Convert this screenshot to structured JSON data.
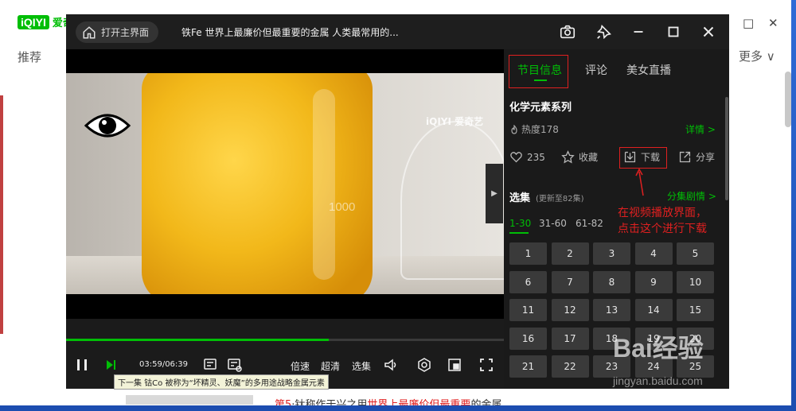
{
  "background": {
    "logo_box": "iQIYI",
    "logo_text": "爱奇",
    "nav_label": "推荐",
    "more_label": "更多 ∨",
    "minimize_icon": "□",
    "close_icon": "✕",
    "bottom_line_plain1": "第5",
    "bottom_line_plain2": "·钛称作于兴之用",
    "bottom_line_red1": "世界上最廉价但最重要",
    "bottom_line_plain3": "的金属"
  },
  "player": {
    "home_button": "打开主界面",
    "title": "铁Fe 世界上最廉价但最重要的金属 人类最常用的...",
    "watermark": "iQIYI 爱奇艺",
    "beaker_label": "1000",
    "time": "03:59/06:39",
    "tooltip": "下一集 钴Co 被称为“坏精灵、妖魔”的多用途战略金属元素",
    "ctrl_speed": "倍速",
    "ctrl_quality": "超清",
    "ctrl_episodes": "选集",
    "progress": 0.6
  },
  "panel": {
    "tabs": [
      "节目信息",
      "评论",
      "美女直播"
    ],
    "series_title": "化学元素系列",
    "heat": "热度178",
    "detail": "详情 >",
    "likes": "235",
    "favorite": "收藏",
    "download": "下载",
    "share": "分享",
    "xuanji": "选集",
    "xuanji_sub": "(更新至82集)",
    "fenjing": "分集剧情 >",
    "ranges": [
      "1-30",
      "31-60",
      "61-82"
    ],
    "episodes": [
      "1",
      "2",
      "3",
      "4",
      "5",
      "6",
      "7",
      "8",
      "9",
      "10",
      "11",
      "12",
      "13",
      "14",
      "15",
      "16",
      "17",
      "18",
      "19",
      "20",
      "21",
      "22",
      "23",
      "24",
      "25"
    ]
  },
  "annotation": {
    "line1": "在视频播放界面，",
    "line2": "点击这个进行下载"
  },
  "baidu": {
    "logo": "Bai经验",
    "url": "jingyan.baidu.com"
  },
  "colors": {
    "accent": "#00be06",
    "annotation": "#e02020"
  }
}
